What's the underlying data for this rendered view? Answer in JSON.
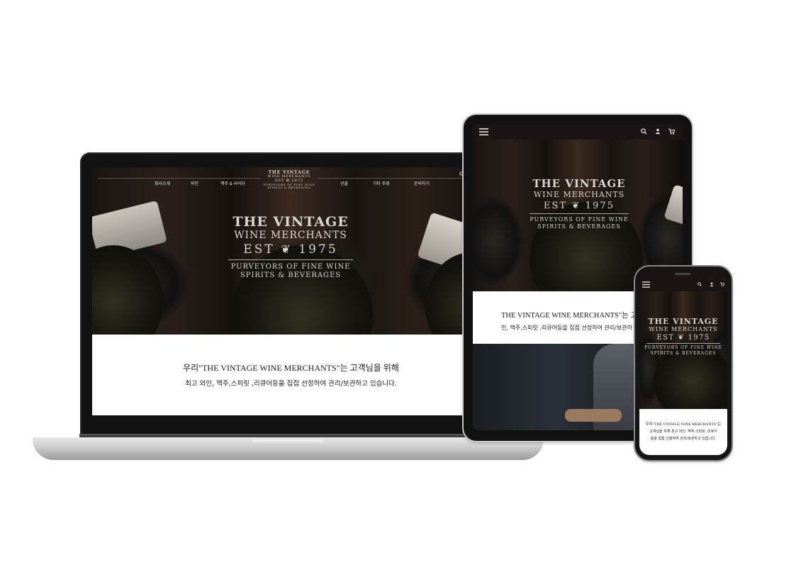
{
  "site": {
    "nav_left": [
      "회사소개",
      "와인",
      "맥주 & 사이다"
    ],
    "nav_right": [
      "선물",
      "기타 주류",
      "문의하기"
    ],
    "logo": {
      "line1": "THE VINTAGE",
      "line2": "WINE MERCHANTS",
      "line3_left": "EST",
      "line3_right": "1975",
      "line4": "PURVEYORS OF FINE WINE",
      "line5": "SPIRITS & BEVERAGES"
    },
    "welcome": {
      "line1": "우리\"THE VINTAGE WINE MERCHANTS\"는 고객님을 위해",
      "line2": "최고 와인, 맥주,스피릿 ,리큐어등을 집접 선정하여 관리/보관하고 있습니다."
    },
    "tablet_welcome": {
      "line1": "THE VINTAGE WINE MERCHANTS\"는 고",
      "line2": "인, 맥주,스피릿 ,리큐어등을 집접 선정하여 관리/보관하"
    },
    "phone_welcome": {
      "line1": "우리\"THE VINTAGE WINE MERCHANTS\"는",
      "line2": "고객님을 위해 최고 와인, 맥주,스피릿 ,리큐어",
      "line3": "등을 집접 선정하여 관리/보관하고 있습니다."
    }
  },
  "icons": {
    "search": "search-icon",
    "account": "user-icon",
    "cart": "cart-icon",
    "menu": "hamburger-menu-icon"
  },
  "colors": {
    "text_light": "#e9e6e0",
    "hero_dark": "#1a1411"
  }
}
